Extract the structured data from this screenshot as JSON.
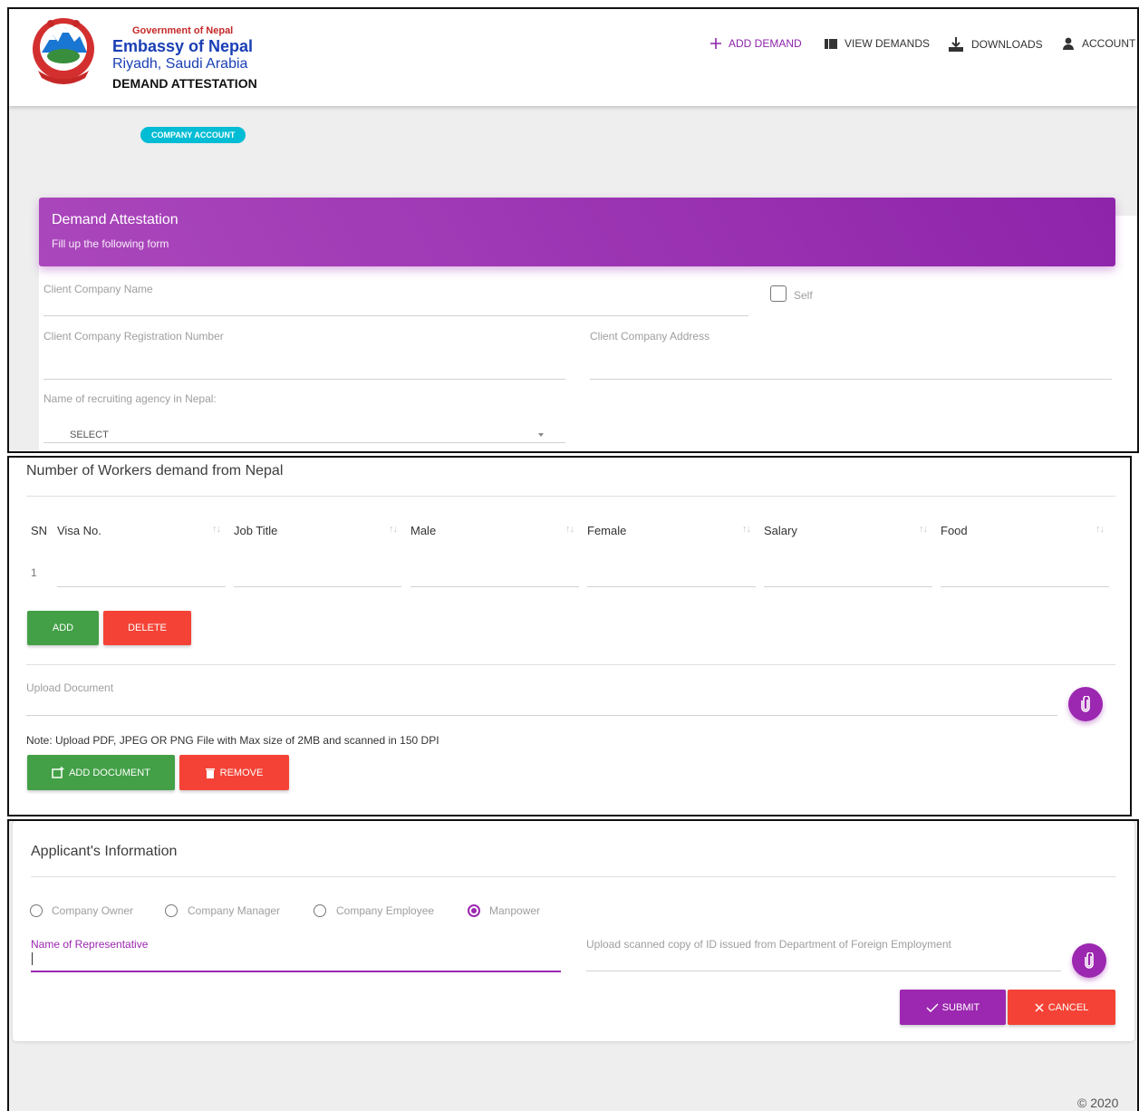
{
  "header": {
    "gov": "Government of Nepal",
    "embassy": "Embassy of Nepal",
    "location": "Riyadh, Saudi Arabia",
    "app": "DEMAND ATTESTATION",
    "nav": {
      "add_demand": "ADD DEMAND",
      "view_demands": "VIEW DEMANDS",
      "downloads": "DOWNLOADS",
      "account": "ACCOUNT"
    }
  },
  "badge": "COMPANY ACCOUNT",
  "form": {
    "title": "Demand Attestation",
    "subtitle": "Fill up the following form",
    "client_company_name": "Client Company Name",
    "self": "Self",
    "registration_number": "Client Company Registration Number",
    "company_address": "Client Company Address",
    "agency_label": "Name of recruiting agency in Nepal:",
    "agency_select": "SELECT"
  },
  "workers": {
    "title": "Number of Workers demand from Nepal",
    "columns": [
      "SN",
      "Visa No.",
      "Job Title",
      "Male",
      "Female",
      "Salary",
      "Food"
    ],
    "rows": [
      {
        "sn": "1"
      }
    ],
    "add": "ADD",
    "delete": "DELETE",
    "upload_label": "Upload Document",
    "note": "Note: Upload PDF, JPEG OR PNG File with Max size of 2MB and scanned in 150 DPI",
    "add_document": "ADD DOCUMENT",
    "remove": "REMOVE"
  },
  "applicant": {
    "title": "Applicant's Information",
    "roles": [
      "Company Owner",
      "Company Manager",
      "Company Employee",
      "Manpower"
    ],
    "selected_role": "Manpower",
    "rep_label": "Name of Representative",
    "upload_id_label": "Upload scanned copy of ID issued from Department of Foreign Employment",
    "submit": "SUBMIT",
    "cancel": "CANCEL"
  },
  "footer": "© 2020",
  "colors": {
    "primary": "#9c27b0",
    "success": "#43a047",
    "danger": "#f44336",
    "info": "#00bcd4"
  }
}
